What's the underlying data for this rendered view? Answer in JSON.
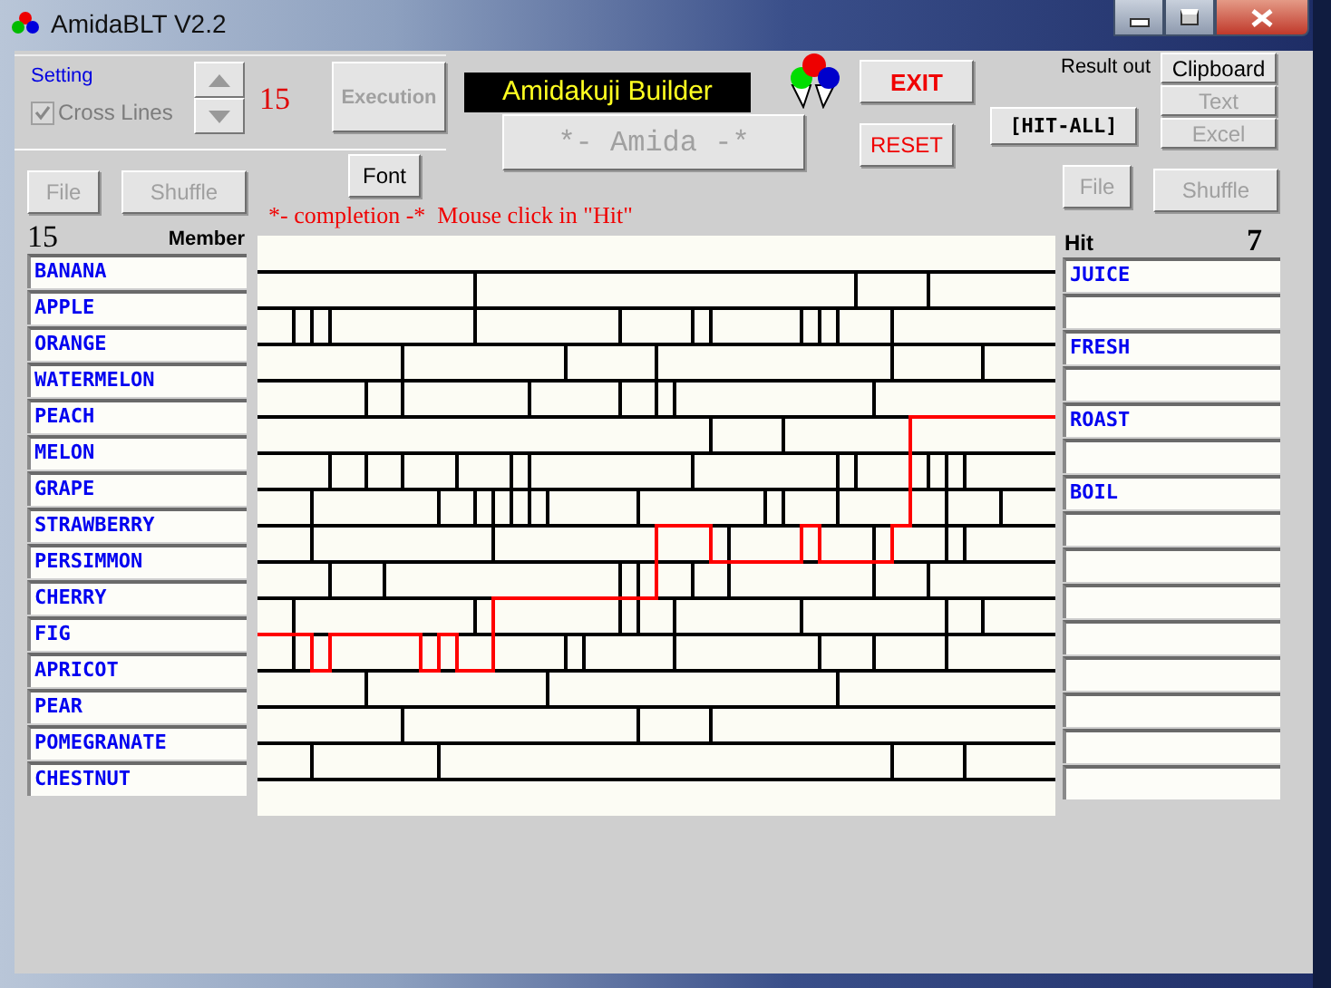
{
  "window": {
    "title": "AmidaBLT V2.2"
  },
  "setting": {
    "label": "Setting",
    "cross_lines": {
      "label": "Cross Lines",
      "checked": true,
      "disabled": true
    },
    "count": "15"
  },
  "execution_button": {
    "label": "Execution",
    "disabled": true
  },
  "font_button": {
    "label": "Font",
    "disabled": false
  },
  "title_banner": "Amidakuji Builder",
  "amida_button": {
    "label": "*- Amida -*",
    "disabled": true
  },
  "exit_button": {
    "label": "EXIT"
  },
  "reset_button": {
    "label": "RESET"
  },
  "hit_all_button": {
    "label": "[HIT-ALL]"
  },
  "result_output": {
    "label": "Result out",
    "buttons": [
      {
        "label": "Clipboard",
        "disabled": false
      },
      {
        "label": "Text",
        "disabled": true
      },
      {
        "label": "Excel",
        "disabled": true
      }
    ]
  },
  "status_text": "*- completion -*  Mouse click in \"Hit\"",
  "members": {
    "count": "15",
    "heading": "Member",
    "file_button": {
      "label": "File",
      "disabled": true
    },
    "shuffle_button": {
      "label": "Shuffle",
      "disabled": true
    },
    "items": [
      {
        "label": "BANANA"
      },
      {
        "label": "APPLE"
      },
      {
        "label": "ORANGE"
      },
      {
        "label": "WATERMELON"
      },
      {
        "label": "PEACH"
      },
      {
        "label": "MELON"
      },
      {
        "label": "GRAPE"
      },
      {
        "label": "STRAWBERRY"
      },
      {
        "label": "PERSIMMON"
      },
      {
        "label": "CHERRY"
      },
      {
        "label": "FIG"
      },
      {
        "label": "APRICOT"
      },
      {
        "label": "PEAR"
      },
      {
        "label": "POMEGRANATE"
      },
      {
        "label": "CHESTNUT"
      }
    ]
  },
  "hits": {
    "heading": "Hit",
    "count": "7",
    "file_button": {
      "label": "File",
      "disabled": true
    },
    "shuffle_button": {
      "label": "Shuffle",
      "disabled": true
    },
    "items": [
      {
        "kind": "text",
        "label": "JUICE"
      },
      {
        "kind": "blank"
      },
      {
        "kind": "text",
        "label": "FRESH"
      },
      {
        "kind": "blank"
      },
      {
        "kind": "text",
        "label": "ROAST"
      },
      {
        "kind": "blank"
      },
      {
        "kind": "text",
        "label": "BOIL"
      },
      {
        "kind": "blank"
      },
      {
        "kind": "blank"
      },
      {
        "kind": "blank"
      },
      {
        "kind": "blank"
      },
      {
        "kind": "blank"
      },
      {
        "kind": "blank"
      },
      {
        "kind": "blank"
      },
      {
        "kind": "blank"
      }
    ]
  }
}
